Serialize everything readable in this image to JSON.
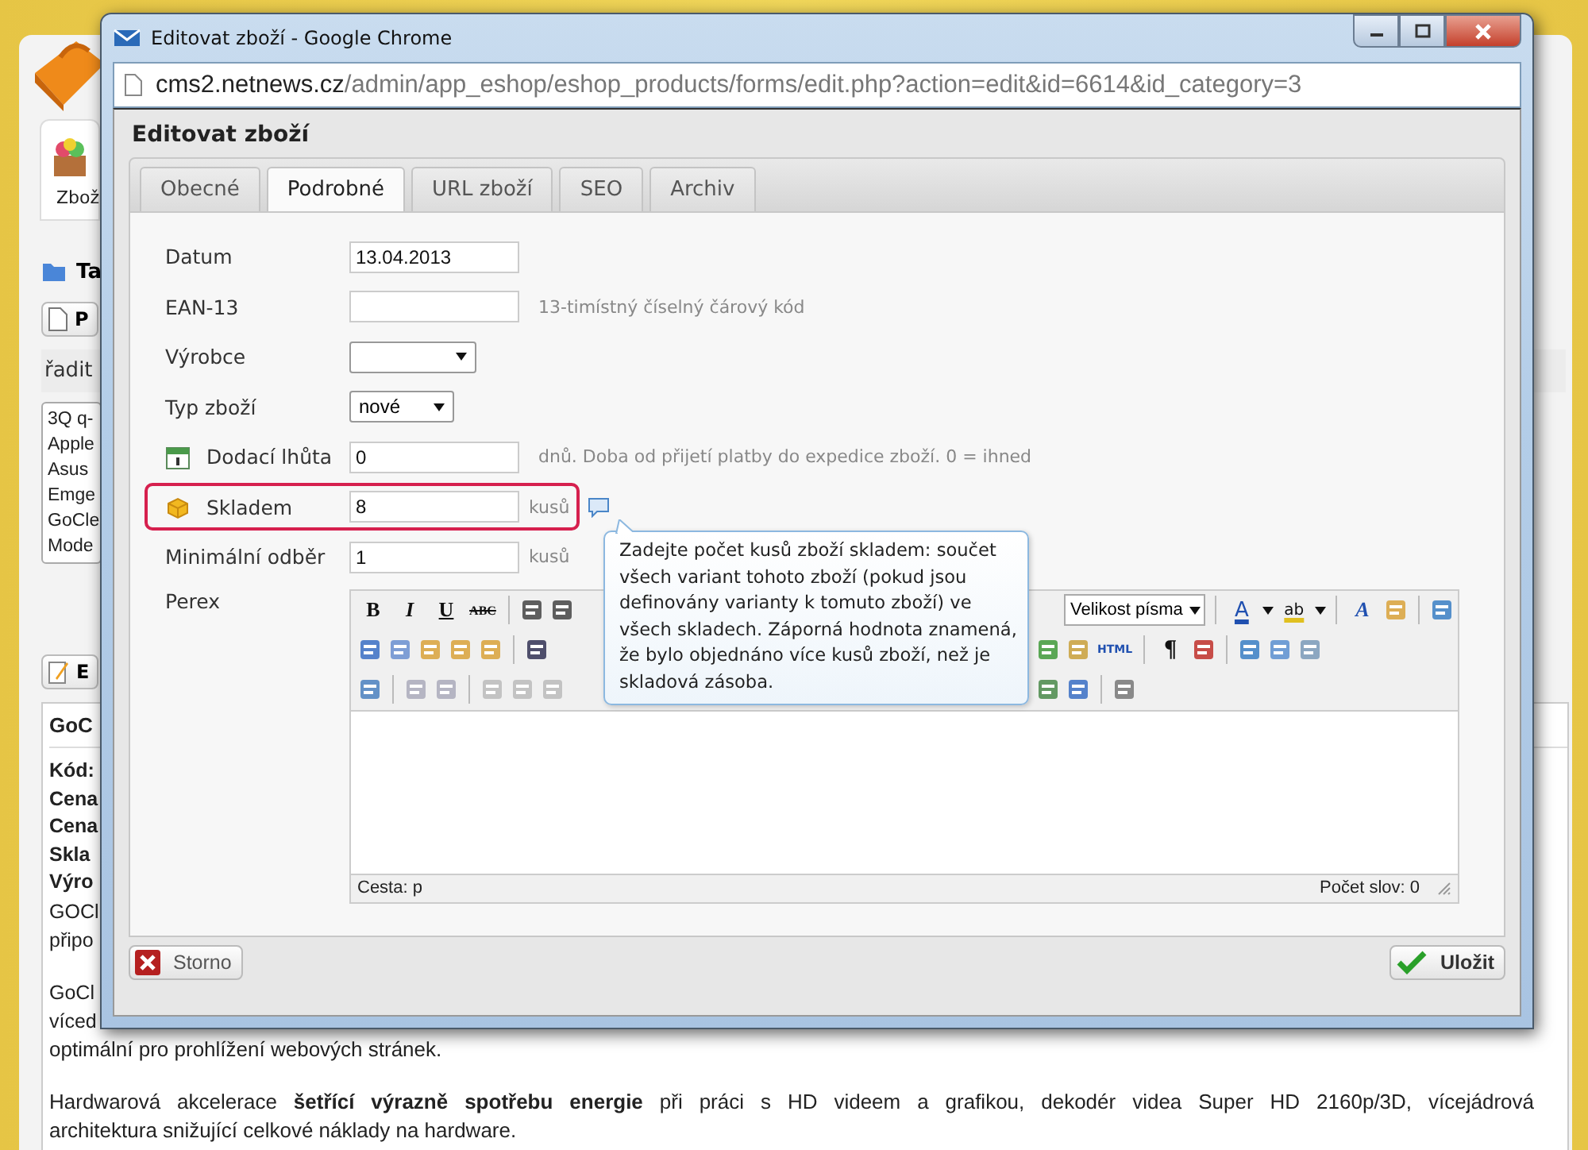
{
  "page": {
    "nav_item": "Zbož",
    "section_title": "Ta",
    "filter_button": "P",
    "sort_label": "řadit",
    "list_items": [
      "3Q q-",
      "Apple",
      "Asus",
      "Emge",
      "GoCle",
      "Mode"
    ],
    "edit_button": "E",
    "product_title": "GoC",
    "detail_labels": [
      "Kód:",
      "Cena",
      "Cena",
      "Skla",
      "Výro"
    ],
    "text_fragments": [
      "GOCl",
      "připo"
    ],
    "paragraph_fragments": [
      "GoCl",
      "víced"
    ],
    "paragraph_end": "optimální pro prohlížení webových stránek.",
    "paragraph_2": [
      "Hardwarová akcelerace **šetřící výrazně spotřebu energie** při práci s HD videem a grafikou, dekodér videa Super HD 2160p/3D, vícejádrová",
      "architektura snižující celkové náklady na hardware."
    ]
  },
  "window": {
    "title": "Editovat zboží - Google Chrome",
    "url_host": "cms2.netnews.cz",
    "url_path": "/admin/app_eshop/eshop_products/forms/edit.php?action=edit&id=6614&id_category=3"
  },
  "heading": "Editovat zboží",
  "tabs": [
    {
      "label": "Obecné",
      "selected": false
    },
    {
      "label": "Podrobné",
      "selected": true
    },
    {
      "label": "URL zboží",
      "selected": false
    },
    {
      "label": "SEO",
      "selected": false
    },
    {
      "label": "Archiv",
      "selected": false
    }
  ],
  "fields": [
    {
      "kind": "text",
      "label": "Datum",
      "value": "13.04.2013",
      "highlighted": false
    },
    {
      "kind": "text",
      "label": "EAN-13",
      "hint": "13-timístný číselný čárový kód",
      "highlighted": false
    },
    {
      "kind": "select",
      "label": "Výrobce",
      "highlighted": false
    },
    {
      "kind": "select",
      "label": "Typ zboží",
      "value": "nové",
      "highlighted": false
    },
    {
      "kind": "delivery",
      "label": "Dodací lhůta",
      "value": "0",
      "hint": "dnů. Doba od přijetí platby do expedice zboží. 0 = ihned",
      "highlighted": false
    },
    {
      "kind": "stock",
      "label": "Skladem",
      "value": "8",
      "unit": "kusů",
      "highlighted": true,
      "help": true
    },
    {
      "kind": "text",
      "label": "Minimální odběr",
      "value": "1",
      "unit": "kusů",
      "highlighted": false
    },
    {
      "kind": "editor",
      "label": "Perex",
      "highlighted": false
    }
  ],
  "editor": {
    "glyphs": [
      "B",
      "I",
      "U",
      "ABC",
      "A",
      "ab",
      "A",
      "HTML",
      "¶"
    ],
    "font_size": "Velikost písma",
    "path": "Cesta: p",
    "word_count": "Počet slov: 0"
  },
  "tooltip": "Zadejte počet kusů zboží skladem: součet všech variant tohoto zboží (pokud jsou definovány varianty k tomuto zboží) ve všech skladech. Záporná hodnota znamená, že bylo objednáno více kusů zboží, než je skladová zásoba.",
  "buttons": [
    {
      "kind": "cancel",
      "label": "Storno"
    },
    {
      "kind": "save",
      "label": "Uložit"
    }
  ]
}
